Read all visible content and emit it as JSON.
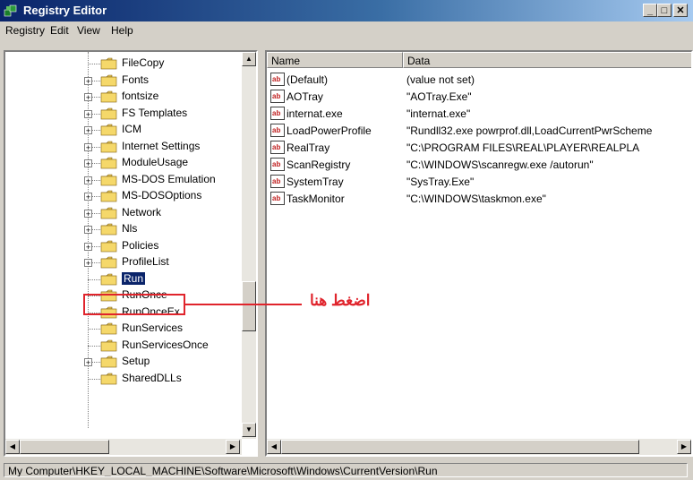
{
  "window": {
    "title": "Registry Editor",
    "minimize_label": "_",
    "maximize_label": "□",
    "close_label": "✕"
  },
  "menu": [
    {
      "label": "Registry"
    },
    {
      "label": "Edit"
    },
    {
      "label": "View"
    },
    {
      "label": "Help"
    }
  ],
  "tree": {
    "items": [
      {
        "label": "FileCopy",
        "expandable": false,
        "selected": false
      },
      {
        "label": "Fonts",
        "expandable": true,
        "selected": false
      },
      {
        "label": "fontsize",
        "expandable": true,
        "selected": false
      },
      {
        "label": "FS Templates",
        "expandable": true,
        "selected": false
      },
      {
        "label": "ICM",
        "expandable": true,
        "selected": false
      },
      {
        "label": "Internet Settings",
        "expandable": true,
        "selected": false
      },
      {
        "label": "ModuleUsage",
        "expandable": true,
        "selected": false
      },
      {
        "label": "MS-DOS Emulation",
        "expandable": true,
        "selected": false
      },
      {
        "label": "MS-DOSOptions",
        "expandable": true,
        "selected": false
      },
      {
        "label": "Network",
        "expandable": true,
        "selected": false
      },
      {
        "label": "Nls",
        "expandable": true,
        "selected": false
      },
      {
        "label": "Policies",
        "expandable": true,
        "selected": false
      },
      {
        "label": "ProfileList",
        "expandable": true,
        "selected": false
      },
      {
        "label": "Run",
        "expandable": false,
        "selected": true
      },
      {
        "label": "RunOnce",
        "expandable": false,
        "selected": false
      },
      {
        "label": "RunOnceEx",
        "expandable": false,
        "selected": false
      },
      {
        "label": "RunServices",
        "expandable": false,
        "selected": false
      },
      {
        "label": "RunServicesOnce",
        "expandable": false,
        "selected": false
      },
      {
        "label": "Setup",
        "expandable": true,
        "selected": false
      },
      {
        "label": "SharedDLLs",
        "expandable": false,
        "selected": false
      }
    ]
  },
  "list": {
    "columns": [
      {
        "label": "Name"
      },
      {
        "label": "Data"
      }
    ],
    "rows": [
      {
        "name": "(Default)",
        "data": "(value not set)"
      },
      {
        "name": "AOTray",
        "data": "\"AOTray.Exe\""
      },
      {
        "name": "internat.exe",
        "data": "\"internat.exe\""
      },
      {
        "name": "LoadPowerProfile",
        "data": "\"Rundll32.exe powrprof.dll,LoadCurrentPwrScheme"
      },
      {
        "name": "RealTray",
        "data": "\"C:\\PROGRAM FILES\\REAL\\PLAYER\\REALPLA"
      },
      {
        "name": "ScanRegistry",
        "data": "\"C:\\WINDOWS\\scanregw.exe /autorun\""
      },
      {
        "name": "SystemTray",
        "data": "\"SysTray.Exe\""
      },
      {
        "name": "TaskMonitor",
        "data": "\"C:\\WINDOWS\\taskmon.exe\""
      }
    ]
  },
  "status": {
    "path": "My Computer\\HKEY_LOCAL_MACHINE\\Software\\Microsoft\\Windows\\CurrentVersion\\Run"
  },
  "annotation": {
    "text": "اضغط هنا",
    "color": "#e0242c"
  },
  "colors": {
    "titlebar_start": "#0a246a",
    "selection": "#0a246a",
    "chrome": "#d4d0c8"
  }
}
